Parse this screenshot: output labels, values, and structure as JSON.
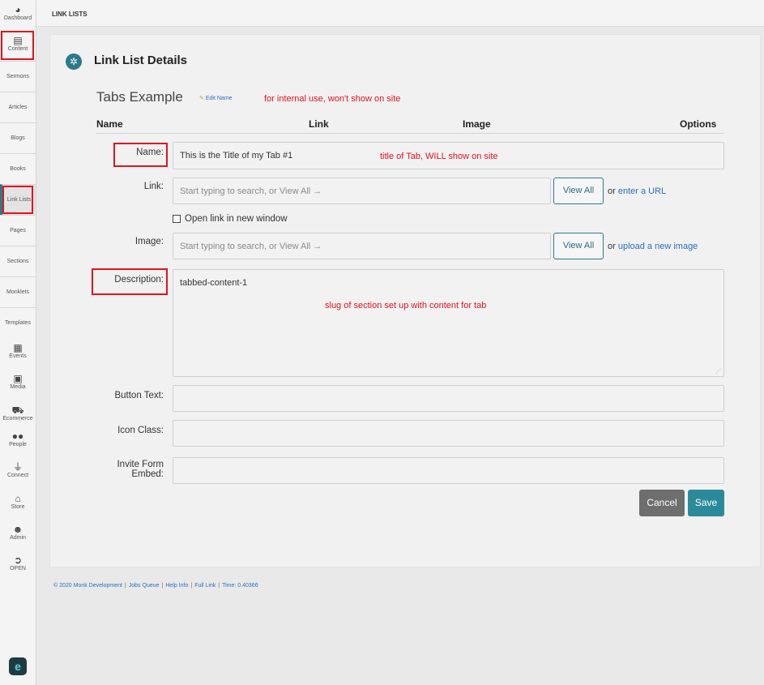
{
  "sidebar": {
    "items": [
      {
        "label": "Dashboard",
        "icon": "dashboard-icon"
      },
      {
        "label": "Content",
        "icon": "document-icon"
      },
      {
        "label": "Sermons"
      },
      {
        "label": "Articles"
      },
      {
        "label": "Blogs"
      },
      {
        "label": "Books"
      },
      {
        "label": "Link Lists"
      },
      {
        "label": "Pages"
      },
      {
        "label": "Sections"
      },
      {
        "label": "Monklets"
      },
      {
        "label": "Templates"
      },
      {
        "label": "Events",
        "icon": "calendar-icon"
      },
      {
        "label": "Media",
        "icon": "media-icon"
      },
      {
        "label": "Ecommerce",
        "icon": "cart-icon"
      },
      {
        "label": "People",
        "icon": "people-icon"
      },
      {
        "label": "Connect",
        "icon": "plug-icon"
      },
      {
        "label": "Store",
        "icon": "store-icon"
      },
      {
        "label": "Admin",
        "icon": "user-icon"
      },
      {
        "label": "OPEN",
        "icon": "chevron-right-icon"
      }
    ],
    "logo": "e"
  },
  "topbar": {
    "breadcrumb": "LINK LISTS"
  },
  "card": {
    "title": "Link List Details",
    "list_name": "Tabs Example",
    "edit_name": "Edit Name",
    "columns": [
      "Name",
      "Link",
      "Image",
      "Options"
    ]
  },
  "annotations": {
    "internal": "for internal use, won't show on site",
    "title": "title of Tab, WILL show on site",
    "slug": "slug of section set up with content for tab"
  },
  "form": {
    "name_label": "Name:",
    "name_value": "This is the Title of my Tab #1",
    "link_label": "Link:",
    "link_placeholder": "Start typing to search, or View All →",
    "view_all": "View All",
    "link_or": "or",
    "link_enter_url": "enter a URL",
    "new_window_label": "Open link in new window",
    "new_window_checked": false,
    "image_label": "Image:",
    "image_placeholder": "Start typing to search, or View All →",
    "image_or": "or",
    "image_upload": "upload a new image",
    "description_label": "Description:",
    "description_value": "tabbed-content-1",
    "button_text_label": "Button Text:",
    "icon_class_label": "Icon Class:",
    "invite_label_1": "Invite Form",
    "invite_label_2": "Embed:",
    "cancel": "Cancel",
    "save": "Save"
  },
  "footer": {
    "copyright": "© 2020 Monk Development",
    "jobs_queue": "Jobs Queue",
    "help_info": "Help Info",
    "full_link": "Full Link",
    "time": "Time: 0.40366"
  },
  "colors": {
    "accent": "#2b8a9a",
    "annotation": "#e0141e",
    "link": "#2a6ebb"
  }
}
